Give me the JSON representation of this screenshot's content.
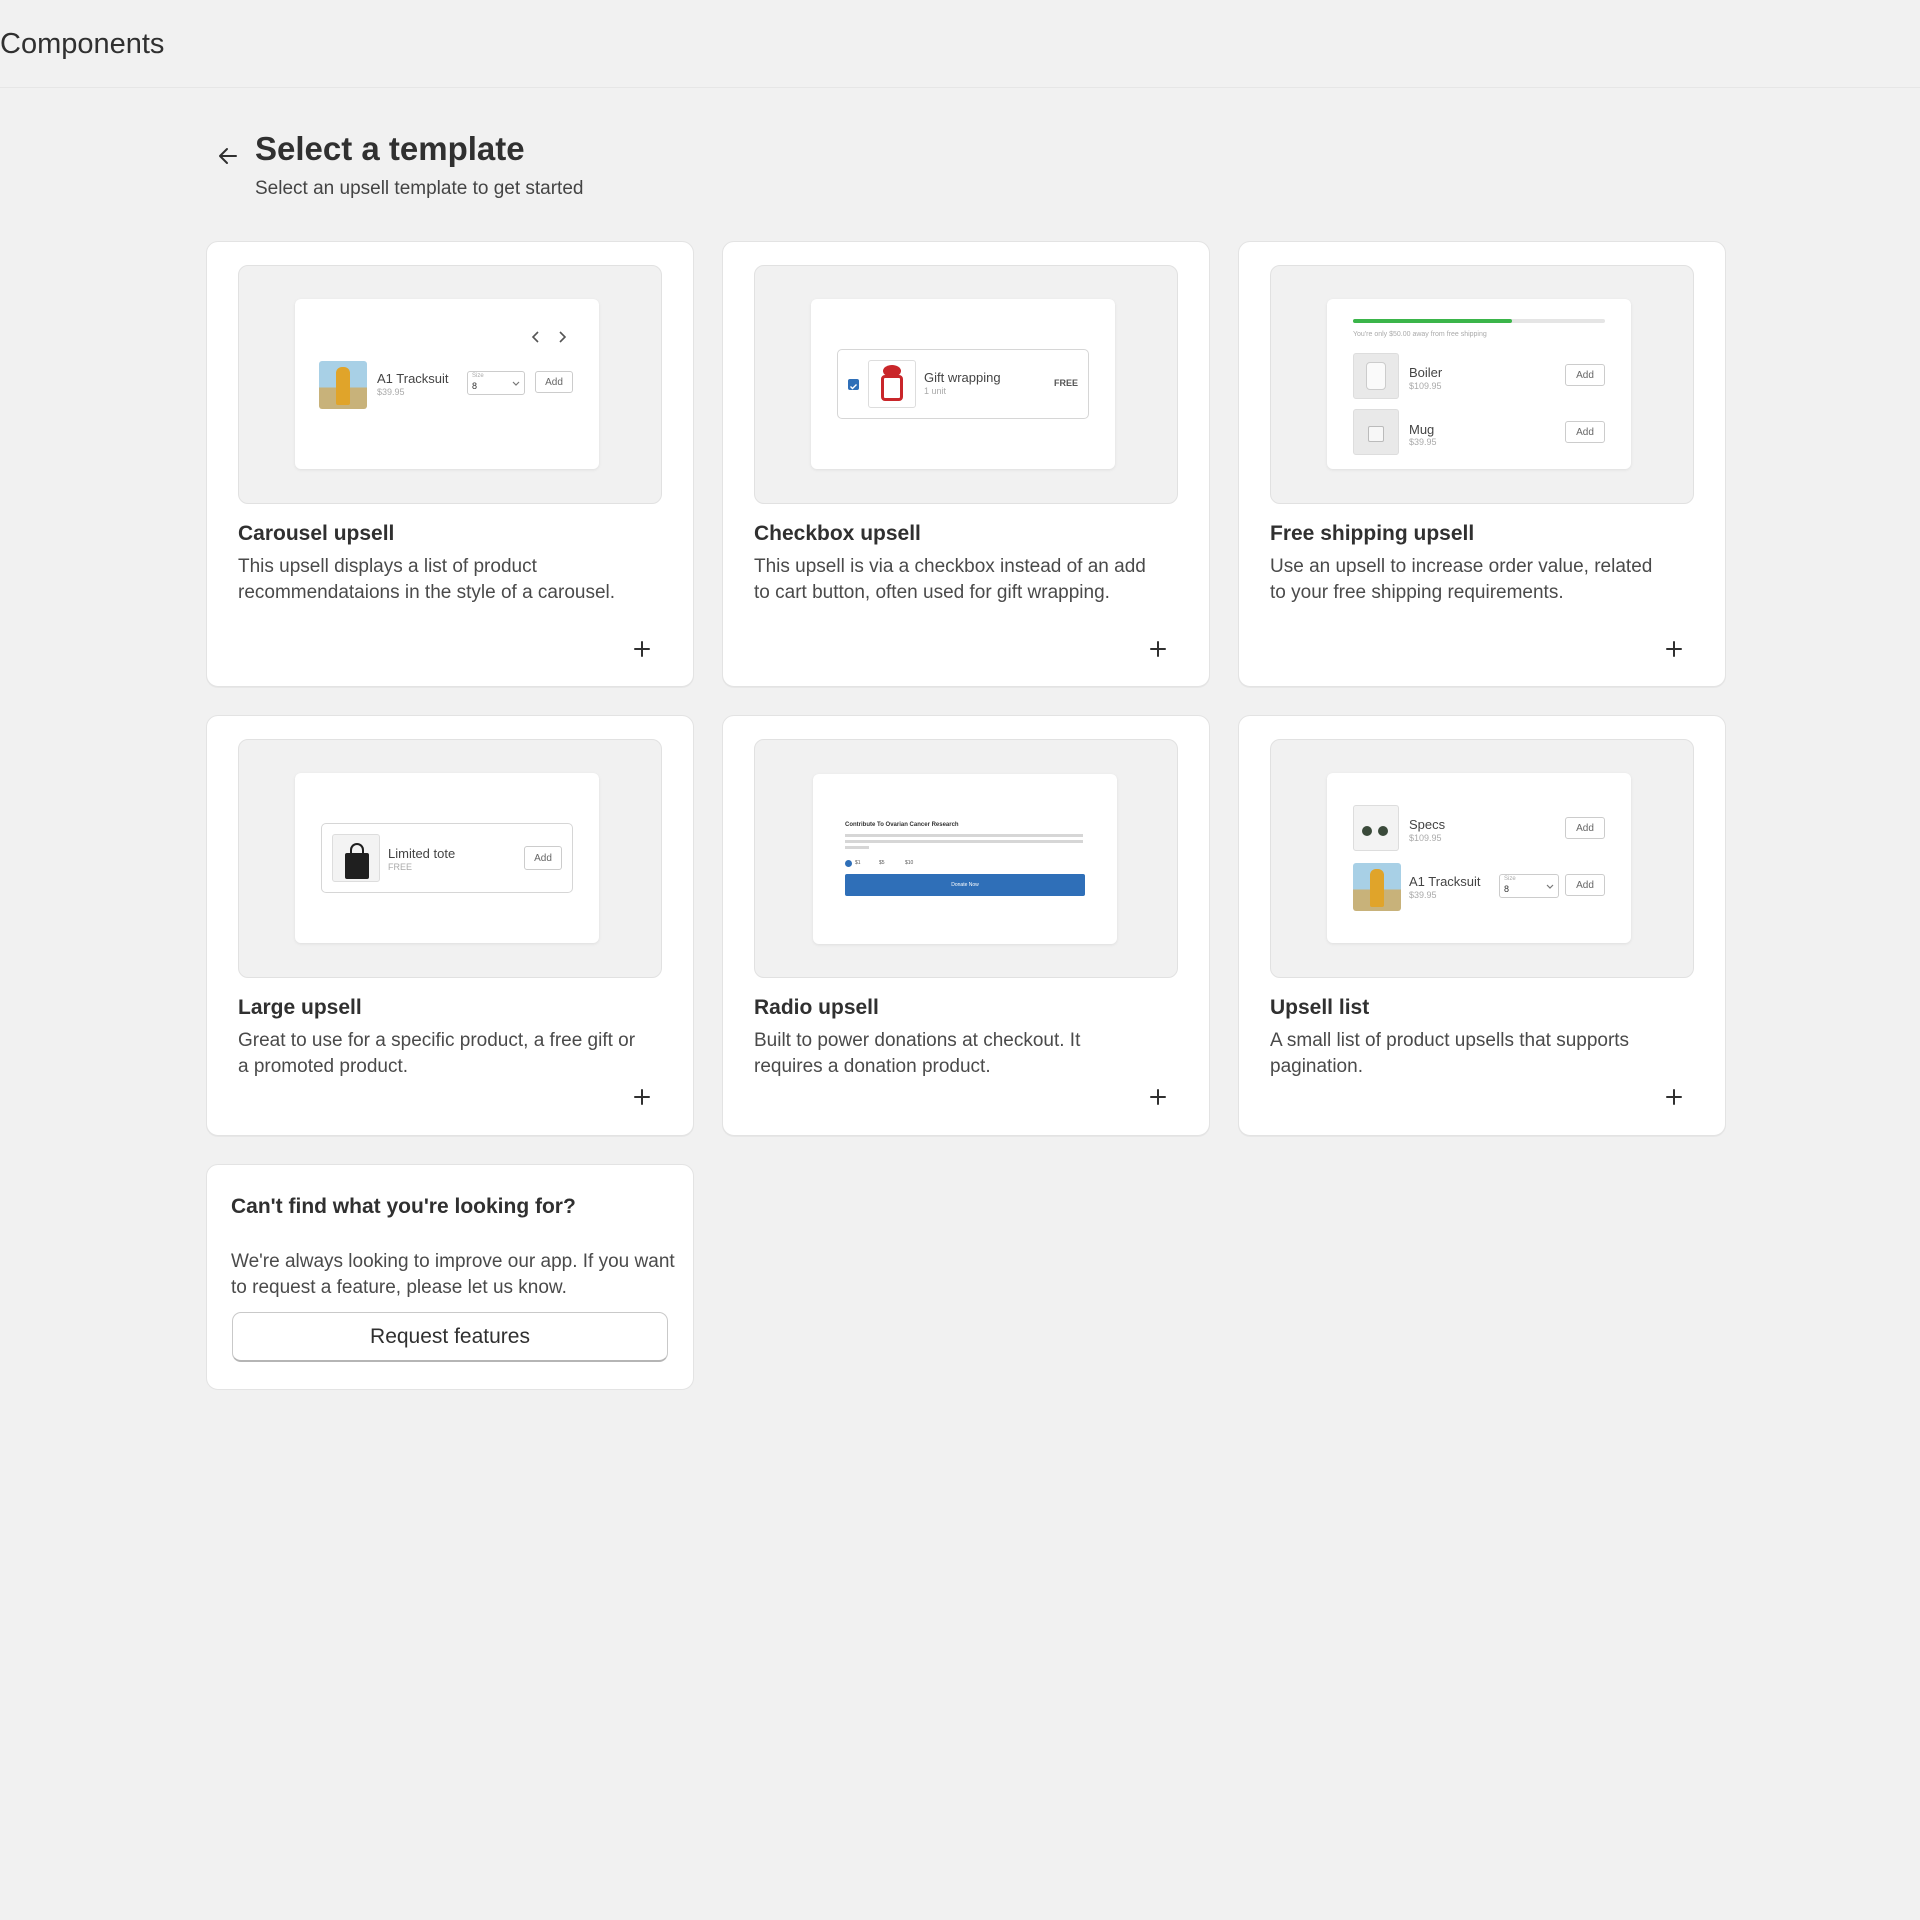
{
  "app": {
    "title": "Components"
  },
  "header": {
    "title": "Select a template",
    "subtitle": "Select an upsell template to get started"
  },
  "templates": [
    {
      "title": "Carousel upsell",
      "description": "This upsell displays a list of product recommendataions in the style of a carousel.",
      "preview": {
        "product": "A1 Tracksuit",
        "price": "$39.95",
        "size_label": "Size",
        "size_value": "8",
        "add": "Add"
      }
    },
    {
      "title": "Checkbox upsell",
      "description": "This upsell is via a checkbox instead of an add to cart button, often used for gift wrapping.",
      "preview": {
        "product": "Gift wrapping",
        "qty": "1 unit",
        "price": "FREE"
      }
    },
    {
      "title": "Free shipping upsell",
      "description": "Use an upsell to increase order value, related to your free shipping requirements.",
      "preview": {
        "progress_text": "You're only $50.00 away from free shipping",
        "progress": 0.63,
        "items": [
          {
            "product": "Boiler",
            "price": "$109.95",
            "add": "Add"
          },
          {
            "product": "Mug",
            "price": "$39.95",
            "add": "Add"
          }
        ]
      }
    },
    {
      "title": "Large upsell",
      "description": "Great to use for a specific product, a free gift or a promoted product.",
      "preview": {
        "product": "Limited tote",
        "price": "FREE",
        "add": "Add"
      }
    },
    {
      "title": "Radio upsell",
      "description": "Built to power donations at checkout. It requires a donation product.",
      "preview": {
        "heading": "Contribute To Ovarian Cancer Research",
        "options": [
          "$1",
          "$5",
          "$10"
        ],
        "button": "Donate Now"
      }
    },
    {
      "title": "Upsell list",
      "description": "A small list of product upsells that supports pagination.",
      "preview": {
        "items": [
          {
            "product": "Specs",
            "price": "$109.95",
            "add": "Add"
          },
          {
            "product": "A1 Tracksuit",
            "price": "$39.95",
            "size_label": "Size",
            "size_value": "8",
            "add": "Add"
          }
        ]
      }
    }
  ],
  "help": {
    "title": "Can't find what you're looking for?",
    "text": "We're always looking to improve our app. If you want to request a feature, please let us know.",
    "button": "Request features"
  },
  "colors": {
    "progress": "#3bb54a",
    "donate_button": "#2f6fb8",
    "checkbox": "#2f6fb8"
  }
}
